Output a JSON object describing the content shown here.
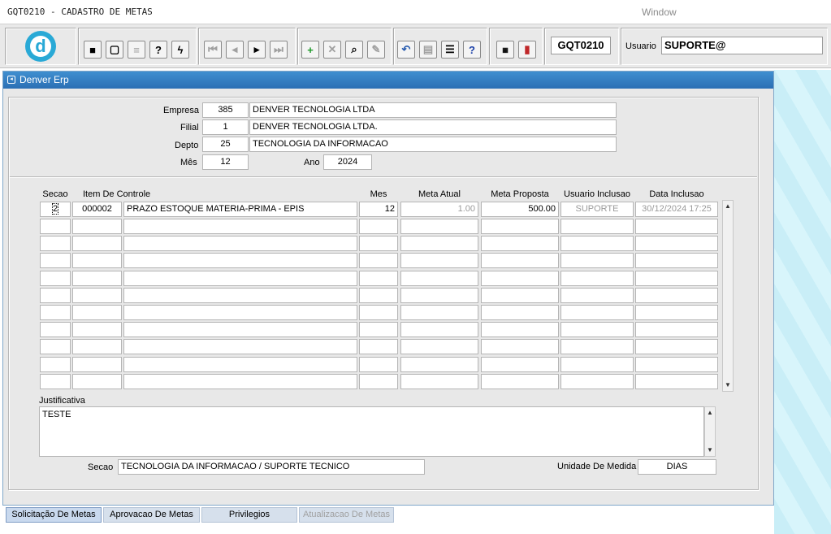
{
  "window": {
    "title": "GQT0210 - CADASTRO DE METAS",
    "menu": "Window"
  },
  "toolbar": {
    "form_code": "GQT0210",
    "usuario_label": "Usuario",
    "usuario_value": "SUPORTE@",
    "icons": [
      "save-icon",
      "window-icon",
      "print-icon",
      "query-help-icon",
      "execute-query-icon",
      "first-record-icon",
      "previous-record-icon",
      "next-record-icon",
      "last-record-icon",
      "insert-record-icon",
      "delete-record-icon",
      "search-icon",
      "edit-icon",
      "undo-icon",
      "clipboard-icon",
      "list-values-icon",
      "help-icon",
      "menu-icon",
      "exit-icon"
    ]
  },
  "main": {
    "title": "Denver Erp",
    "header": {
      "empresa_label": "Empresa",
      "empresa_code": "385",
      "empresa_name": "DENVER TECNOLOGIA LTDA",
      "filial_label": "Filial",
      "filial_code": "1",
      "filial_name": "DENVER TECNOLOGIA LTDA.",
      "depto_label": "Depto",
      "depto_code": "25",
      "depto_name": "TECNOLOGIA DA INFORMACAO",
      "mes_label": "Mês",
      "mes_value": "12",
      "ano_label": "Ano",
      "ano_value": "2024"
    },
    "grid": {
      "columns": [
        "Secao",
        "Item De Controle",
        "Mes",
        "Meta Atual",
        "Meta Proposta",
        "Usuario Inclusao",
        "Data Inclusao"
      ],
      "rows": [
        {
          "secao": "2",
          "item_code": "000002",
          "item_desc": "PRAZO ESTOQUE MATERIA-PRIMA - EPIS",
          "mes": "12",
          "meta_atual": "1.00",
          "meta_proposta": "500.00",
          "usuario_inclusao": "SUPORTE",
          "data_inclusao": "30/12/2024 17:25"
        }
      ],
      "empty_rows": 10
    },
    "justificativa_label": "Justificativa",
    "justificativa_value": "TESTE",
    "secao_label": "Secao",
    "secao_value": "TECNOLOGIA DA INFORMACAO / SUPORTE TECNICO",
    "unidade_label": "Unidade De Medida",
    "unidade_value": "DIAS"
  },
  "tabs": [
    {
      "label": "Solicitação De Metas",
      "state": "active"
    },
    {
      "label": "Aprovacao De Metas",
      "state": "normal"
    },
    {
      "label": "Privilegios",
      "state": "normal"
    },
    {
      "label": "Atualizacao De Metas",
      "state": "disabled"
    }
  ]
}
